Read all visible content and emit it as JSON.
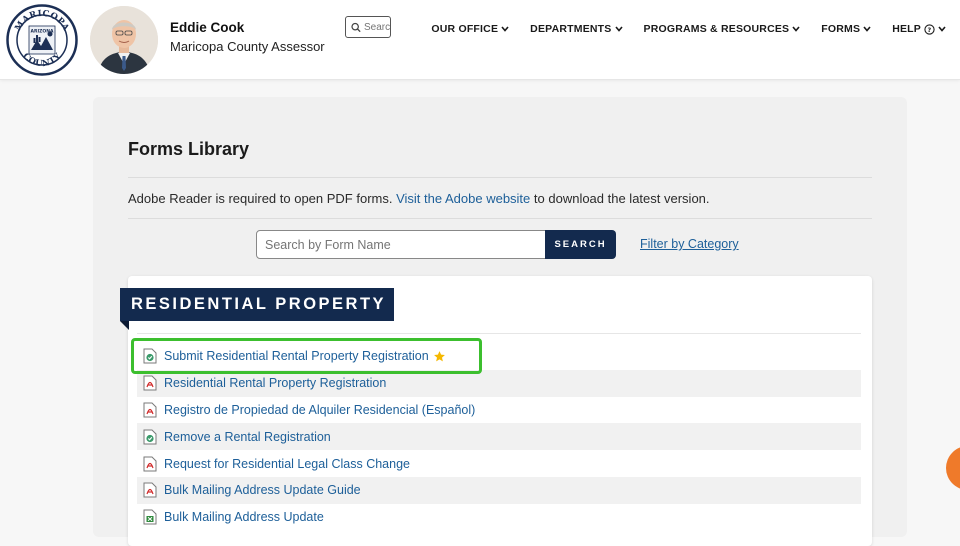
{
  "header": {
    "seal_text_top": "MARICOPA",
    "seal_text_mid": "ARIZONA",
    "seal_text_bottom": "COUNTY",
    "official_name": "Eddie Cook",
    "official_title": "Maricopa County Assessor",
    "search_placeholder": "Search"
  },
  "nav": [
    {
      "label": "OUR OFFICE",
      "icon": "chevron-down-icon"
    },
    {
      "label": "DEPARTMENTS",
      "icon": "chevron-down-icon"
    },
    {
      "label": "PROGRAMS & RESOURCES",
      "icon": "chevron-down-icon"
    },
    {
      "label": "FORMS",
      "icon": "chevron-down-icon"
    },
    {
      "label": "HELP",
      "icon": "help-circle-icon"
    }
  ],
  "main": {
    "title": "Forms Library",
    "notice_before": "Adobe Reader is required to open PDF forms.",
    "notice_link": "Visit the Adobe website",
    "notice_after": "to download the latest version.",
    "form_search_placeholder": "Search by Form Name",
    "search_button": "SEARCH",
    "filter_link": "Filter by Category"
  },
  "category": {
    "name": "RESIDENTIAL PROPERTY",
    "forms": [
      {
        "label": "Submit Residential Rental Property Registration",
        "icon": "online-form-icon",
        "starred": true,
        "highlighted": true
      },
      {
        "label": "Residential Rental Property Registration",
        "icon": "pdf-icon"
      },
      {
        "label": "Registro de Propiedad de Alquiler Residencial (Español)",
        "icon": "pdf-icon"
      },
      {
        "label": "Remove a Rental Registration",
        "icon": "online-form-icon"
      },
      {
        "label": "Request for Residential Legal Class Change",
        "icon": "pdf-icon"
      },
      {
        "label": "Bulk Mailing Address Update Guide",
        "icon": "pdf-icon"
      },
      {
        "label": "Bulk Mailing Address Update",
        "icon": "spreadsheet-icon"
      }
    ]
  },
  "colors": {
    "brand_navy": "#132a4e",
    "link_blue": "#1d5f99",
    "highlight_green": "#3cbf2e",
    "accent_orange": "#ef7a2a"
  }
}
